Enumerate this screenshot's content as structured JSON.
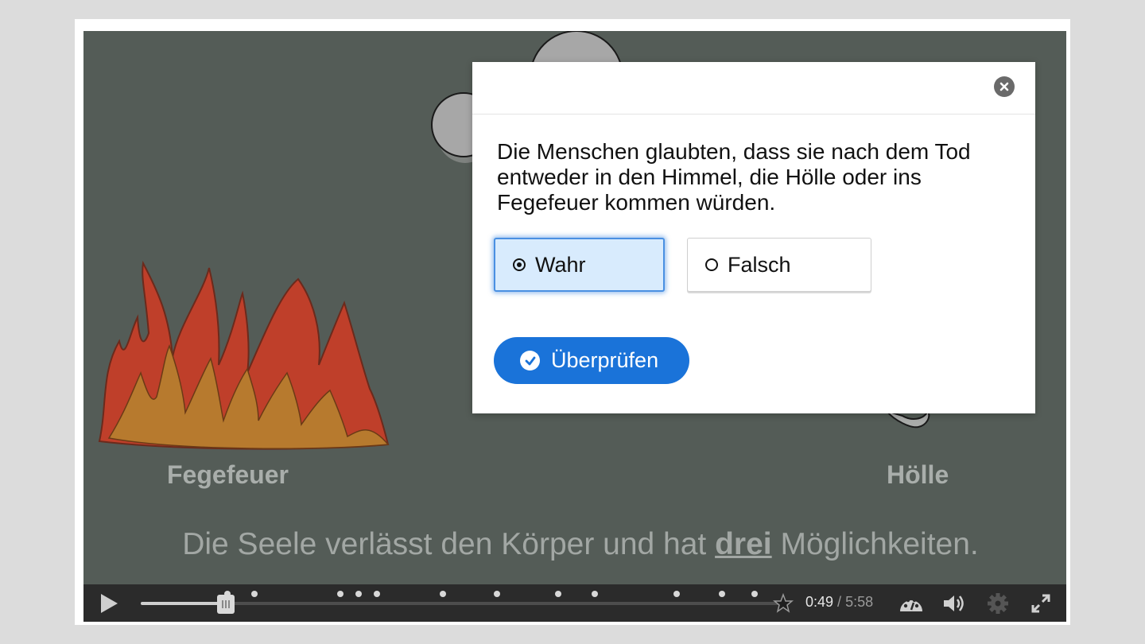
{
  "scene": {
    "label_left": "Fegefeuer",
    "label_right": "Hölle",
    "caption_before": "Die Seele verlässt den Körper und hat ",
    "caption_emphasis": "drei",
    "caption_after": " Möglichkeiten."
  },
  "dialog": {
    "question": "Die Menschen glaubten, dass sie nach dem Tod entweder in den Himmel, die Hölle oder ins Fegefeuer kommen würden.",
    "options": [
      {
        "label": "Wahr",
        "selected": true
      },
      {
        "label": "Falsch",
        "selected": false
      }
    ],
    "check_label": "Überprüfen",
    "close_icon": "close-icon",
    "accent_color": "#1a73d9"
  },
  "player": {
    "current_time": "0:49",
    "separator": " / ",
    "duration": "5:58",
    "progress": 0.137,
    "icons": [
      "play-icon",
      "bookmark-star-icon",
      "playback-speed-icon",
      "volume-icon",
      "settings-gear-icon",
      "fullscreen-icon"
    ]
  }
}
